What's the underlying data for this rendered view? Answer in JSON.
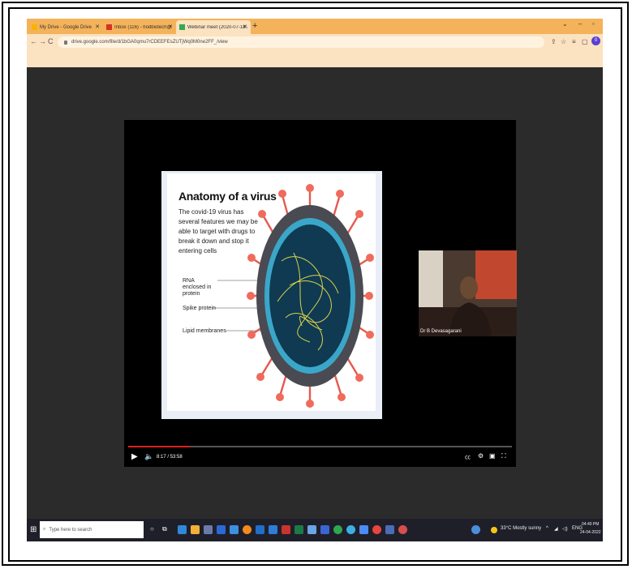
{
  "browser": {
    "tabs": [
      {
        "label": "My Drive - Google Drive",
        "fav_color": "#f4b400"
      },
      {
        "label": "Inbox (116) - hodbiotech@sru.edu",
        "fav_color": "#d93025"
      },
      {
        "label": "Webinar meet (2020-07-18 at 1...",
        "fav_color": "#34a853"
      }
    ],
    "new_tab_icon": "+",
    "url": "drive.google.com/file/d/1bGA0qmu7rCDEEFEsZUTjWq0M0ne2FF_/view",
    "profile_initial": "0"
  },
  "slide": {
    "title": "Anatomy of a virus",
    "subtitle": "The covid-19 virus has several features we may be able to target with drugs to break it down and stop it entering cells",
    "labels": [
      "RNA enclosed in protein",
      "Spike protein",
      "Lipid membranes"
    ]
  },
  "participant": {
    "name": "Dr B Devasagarani"
  },
  "player": {
    "time": "8:17 / 53:58",
    "progress_fraction": 0.16
  },
  "taskbar": {
    "search_placeholder": "Type here to search",
    "weather": "33°C  Mostly sunny",
    "lang": "ENG",
    "time": "04:40 PM",
    "date": "24-04-2022"
  }
}
